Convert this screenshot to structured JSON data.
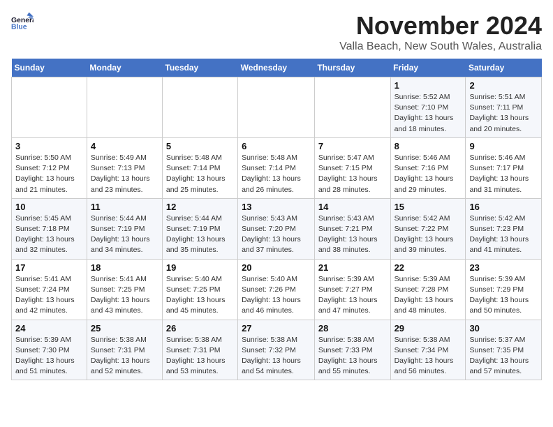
{
  "header": {
    "logo_line1": "General",
    "logo_line2": "Blue",
    "month": "November 2024",
    "location": "Valla Beach, New South Wales, Australia"
  },
  "weekdays": [
    "Sunday",
    "Monday",
    "Tuesday",
    "Wednesday",
    "Thursday",
    "Friday",
    "Saturday"
  ],
  "weeks": [
    [
      {
        "day": "",
        "info": ""
      },
      {
        "day": "",
        "info": ""
      },
      {
        "day": "",
        "info": ""
      },
      {
        "day": "",
        "info": ""
      },
      {
        "day": "",
        "info": ""
      },
      {
        "day": "1",
        "info": "Sunrise: 5:52 AM\nSunset: 7:10 PM\nDaylight: 13 hours and 18 minutes."
      },
      {
        "day": "2",
        "info": "Sunrise: 5:51 AM\nSunset: 7:11 PM\nDaylight: 13 hours and 20 minutes."
      }
    ],
    [
      {
        "day": "3",
        "info": "Sunrise: 5:50 AM\nSunset: 7:12 PM\nDaylight: 13 hours and 21 minutes."
      },
      {
        "day": "4",
        "info": "Sunrise: 5:49 AM\nSunset: 7:13 PM\nDaylight: 13 hours and 23 minutes."
      },
      {
        "day": "5",
        "info": "Sunrise: 5:48 AM\nSunset: 7:14 PM\nDaylight: 13 hours and 25 minutes."
      },
      {
        "day": "6",
        "info": "Sunrise: 5:48 AM\nSunset: 7:14 PM\nDaylight: 13 hours and 26 minutes."
      },
      {
        "day": "7",
        "info": "Sunrise: 5:47 AM\nSunset: 7:15 PM\nDaylight: 13 hours and 28 minutes."
      },
      {
        "day": "8",
        "info": "Sunrise: 5:46 AM\nSunset: 7:16 PM\nDaylight: 13 hours and 29 minutes."
      },
      {
        "day": "9",
        "info": "Sunrise: 5:46 AM\nSunset: 7:17 PM\nDaylight: 13 hours and 31 minutes."
      }
    ],
    [
      {
        "day": "10",
        "info": "Sunrise: 5:45 AM\nSunset: 7:18 PM\nDaylight: 13 hours and 32 minutes."
      },
      {
        "day": "11",
        "info": "Sunrise: 5:44 AM\nSunset: 7:19 PM\nDaylight: 13 hours and 34 minutes."
      },
      {
        "day": "12",
        "info": "Sunrise: 5:44 AM\nSunset: 7:19 PM\nDaylight: 13 hours and 35 minutes."
      },
      {
        "day": "13",
        "info": "Sunrise: 5:43 AM\nSunset: 7:20 PM\nDaylight: 13 hours and 37 minutes."
      },
      {
        "day": "14",
        "info": "Sunrise: 5:43 AM\nSunset: 7:21 PM\nDaylight: 13 hours and 38 minutes."
      },
      {
        "day": "15",
        "info": "Sunrise: 5:42 AM\nSunset: 7:22 PM\nDaylight: 13 hours and 39 minutes."
      },
      {
        "day": "16",
        "info": "Sunrise: 5:42 AM\nSunset: 7:23 PM\nDaylight: 13 hours and 41 minutes."
      }
    ],
    [
      {
        "day": "17",
        "info": "Sunrise: 5:41 AM\nSunset: 7:24 PM\nDaylight: 13 hours and 42 minutes."
      },
      {
        "day": "18",
        "info": "Sunrise: 5:41 AM\nSunset: 7:25 PM\nDaylight: 13 hours and 43 minutes."
      },
      {
        "day": "19",
        "info": "Sunrise: 5:40 AM\nSunset: 7:25 PM\nDaylight: 13 hours and 45 minutes."
      },
      {
        "day": "20",
        "info": "Sunrise: 5:40 AM\nSunset: 7:26 PM\nDaylight: 13 hours and 46 minutes."
      },
      {
        "day": "21",
        "info": "Sunrise: 5:39 AM\nSunset: 7:27 PM\nDaylight: 13 hours and 47 minutes."
      },
      {
        "day": "22",
        "info": "Sunrise: 5:39 AM\nSunset: 7:28 PM\nDaylight: 13 hours and 48 minutes."
      },
      {
        "day": "23",
        "info": "Sunrise: 5:39 AM\nSunset: 7:29 PM\nDaylight: 13 hours and 50 minutes."
      }
    ],
    [
      {
        "day": "24",
        "info": "Sunrise: 5:39 AM\nSunset: 7:30 PM\nDaylight: 13 hours and 51 minutes."
      },
      {
        "day": "25",
        "info": "Sunrise: 5:38 AM\nSunset: 7:31 PM\nDaylight: 13 hours and 52 minutes."
      },
      {
        "day": "26",
        "info": "Sunrise: 5:38 AM\nSunset: 7:31 PM\nDaylight: 13 hours and 53 minutes."
      },
      {
        "day": "27",
        "info": "Sunrise: 5:38 AM\nSunset: 7:32 PM\nDaylight: 13 hours and 54 minutes."
      },
      {
        "day": "28",
        "info": "Sunrise: 5:38 AM\nSunset: 7:33 PM\nDaylight: 13 hours and 55 minutes."
      },
      {
        "day": "29",
        "info": "Sunrise: 5:38 AM\nSunset: 7:34 PM\nDaylight: 13 hours and 56 minutes."
      },
      {
        "day": "30",
        "info": "Sunrise: 5:37 AM\nSunset: 7:35 PM\nDaylight: 13 hours and 57 minutes."
      }
    ]
  ]
}
